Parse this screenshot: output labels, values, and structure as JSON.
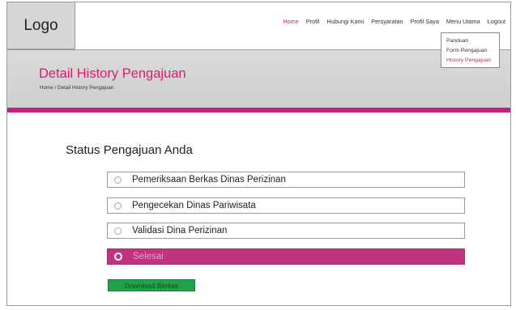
{
  "header": {
    "logo": "Logo",
    "nav": [
      "Home",
      "Profil",
      "Hubungi Kami",
      "Persyaratan",
      "Profil Saya",
      "Menu Utama",
      "Logout"
    ],
    "active_nav": "Home"
  },
  "dropdown": {
    "items": [
      "Panduan",
      "Form Pengajuan",
      "History Pengajuan"
    ],
    "active_item": "History Pengajuan"
  },
  "banner": {
    "title": "Detail History Pengajuan",
    "breadcrumb": "Home / Detail History Pengajuan"
  },
  "status": {
    "title": "Status Pengajuan Anda",
    "options": [
      {
        "label": "Pemeriksaan Berkas Dinas Perizinan",
        "selected": false
      },
      {
        "label": "Pengecekan Dinas Pariwisata",
        "selected": false
      },
      {
        "label": "Validasi Dina Perizinan",
        "selected": false
      },
      {
        "label": "Selesai",
        "selected": true
      }
    ]
  },
  "download_button": "Download Berkas",
  "colors": {
    "accent": "#d81b74",
    "pink_bar": "#c6207e",
    "selected_row": "#c0337f",
    "download_green": "#22a14b"
  }
}
